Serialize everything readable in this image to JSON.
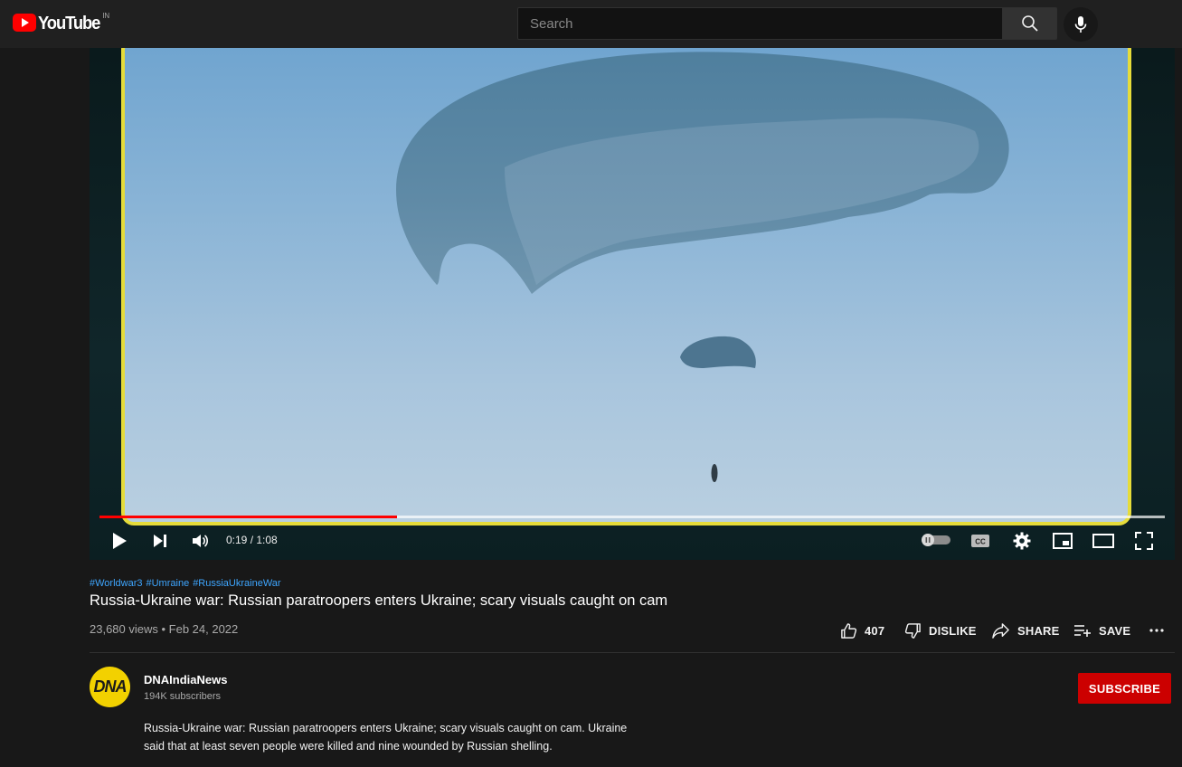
{
  "masthead": {
    "logo_text": "YouTube",
    "country_code": "IN",
    "search_placeholder": "Search"
  },
  "player": {
    "current_time": "0:19",
    "duration": "1:08",
    "time_display": "0:19 / 1:08",
    "progress_fraction": 0.279,
    "buffered_fraction": 1.0,
    "frame_border_color": "#e6dc3a",
    "progress_color": "#ff0000"
  },
  "video": {
    "hashtags": [
      "#Worldwar3",
      "#Umraine",
      "#RussiaUkraineWar"
    ],
    "title": "Russia-Ukraine war: Russian paratroopers enters Ukraine; scary visuals caught on cam",
    "views_line": "23,680 views • Feb 24, 2022"
  },
  "actions": {
    "like_count": "407",
    "dislike_label": "DISLIKE",
    "share_label": "SHARE",
    "save_label": "SAVE"
  },
  "channel": {
    "avatar_text": "DNA",
    "name": "DNAIndiaNews",
    "subscribers": "194K subscribers",
    "subscribe_label": "SUBSCRIBE",
    "description_line1": "Russia-Ukraine war: Russian paratroopers enters Ukraine; scary visuals caught on cam.  Ukraine",
    "description_line2": "said that at least seven people were killed and nine wounded by Russian shelling."
  },
  "colors": {
    "background": "#181818",
    "masthead": "#202020",
    "link": "#3ea6ff",
    "subscribe": "#cc0000"
  },
  "icons": [
    "youtube-logo-icon",
    "search-icon",
    "mic-icon",
    "play-icon",
    "next-icon",
    "volume-icon",
    "autoplay-icon",
    "captions-icon",
    "settings-icon",
    "miniplayer-icon",
    "theater-icon",
    "fullscreen-icon",
    "like-icon",
    "dislike-icon",
    "share-icon",
    "save-icon",
    "more-icon"
  ]
}
